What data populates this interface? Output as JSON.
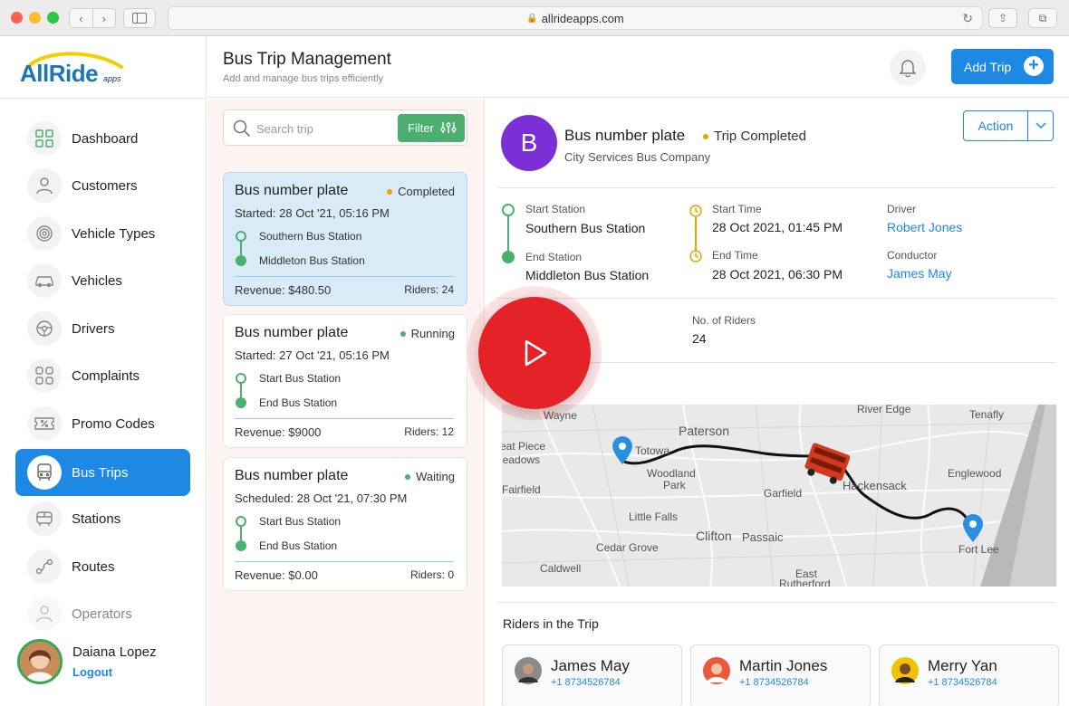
{
  "browser": {
    "url": "allrideapps.com"
  },
  "brand": {
    "logo_main": "AllRide",
    "logo_sub": "apps",
    "accent": "#1e88e5",
    "green": "#4caf70"
  },
  "sidebar": {
    "items": [
      {
        "label": "Dashboard",
        "icon": "dashboard-grid-icon"
      },
      {
        "label": "Customers",
        "icon": "user-icon"
      },
      {
        "label": "Vehicle Types",
        "icon": "vehicle-types-icon"
      },
      {
        "label": "Vehicles",
        "icon": "car-icon"
      },
      {
        "label": "Drivers",
        "icon": "steering-wheel-icon"
      },
      {
        "label": "Complaints",
        "icon": "complaints-icon"
      },
      {
        "label": "Promo Codes",
        "icon": "promo-ticket-icon"
      },
      {
        "label": "Bus Trips",
        "icon": "bus-icon",
        "active": true
      },
      {
        "label": "Stations",
        "icon": "station-icon"
      },
      {
        "label": "Routes",
        "icon": "routes-icon"
      },
      {
        "label": "Operators",
        "icon": "operator-icon"
      }
    ],
    "user": {
      "name": "Daiana Lopez",
      "logout": "Logout"
    }
  },
  "header": {
    "title": "Bus Trip Management",
    "subtitle": "Add and manage bus trips efficiently",
    "add_trip": "Add Trip"
  },
  "search": {
    "placeholder": "Search trip",
    "filter_label": "Filter"
  },
  "trips": [
    {
      "name": "Bus number plate",
      "status": "Completed",
      "status_color": "#e6a500",
      "date": "Started: 28 Oct '21, 05:16 PM",
      "start": "Southern Bus Station",
      "end": "Middleton Bus Station",
      "revenue": "Revenue: $480.50",
      "riders": "Riders: 24",
      "selected": true
    },
    {
      "name": "Bus number plate",
      "status": "Running",
      "status_color": "#4caf70",
      "date": "Started: 27 Oct '21, 05:16 PM",
      "start": "Start Bus Station",
      "end": "End Bus Station",
      "revenue": "Revenue: $9000",
      "riders": "Riders: 12"
    },
    {
      "name": "Bus number plate",
      "status": "Waiting",
      "status_color": "#4caf70",
      "date": "Scheduled: 28 Oct '21, 07:30 PM",
      "start": "Start Bus Station",
      "end": "End Bus Station",
      "revenue": "Revenue: $0.00",
      "riders": "Riders: 0"
    }
  ],
  "detail": {
    "avatar_letter": "B",
    "title": "Bus number plate",
    "status": "Trip Completed",
    "company": "City Services Bus Company",
    "action": "Action",
    "start_station_label": "Start Station",
    "start_station": "Southern Bus Station",
    "end_station_label": "End Station",
    "end_station": "Middleton Bus Station",
    "start_time_label": "Start Time",
    "start_time": "28 Oct 2021, 01:45 PM",
    "end_time_label": "End Time",
    "end_time": "28 Oct 2021, 06:30 PM",
    "driver_label": "Driver",
    "driver": "Robert Jones",
    "conductor_label": "Conductor",
    "conductor": "James May",
    "riders_count_label": "No. of Riders",
    "riders_count": "24",
    "map_labels": [
      "Wayne",
      "Paterson",
      "River Edge",
      "Tenafly",
      "Totowa",
      "eat Piece",
      "leadows",
      "Woodland",
      "Park",
      "Hackensack",
      "Englewood",
      "Fairfield",
      "Garfield",
      "Little Falls",
      "Clifton",
      "Passaic",
      "Cedar Grove",
      "Caldwell",
      "East",
      "Rutherford",
      "Fort Lee"
    ],
    "riders_title": "Riders in the Trip",
    "riders": [
      {
        "name": "James May",
        "phone": "+1 8734526784"
      },
      {
        "name": "Martin Jones",
        "phone": "+1 8734526784"
      },
      {
        "name": "Merry Yan",
        "phone": "+1 8734526784"
      }
    ]
  }
}
